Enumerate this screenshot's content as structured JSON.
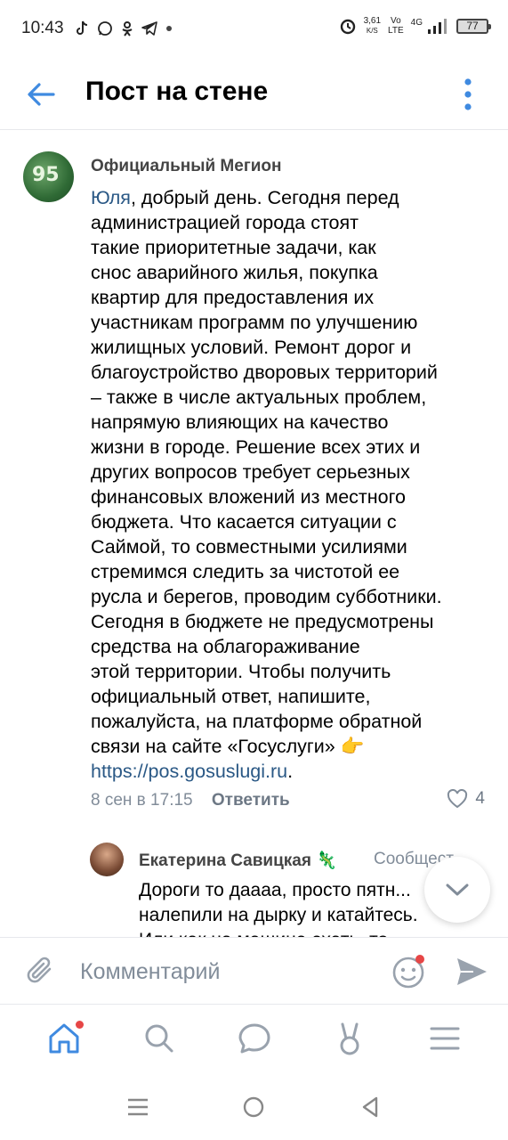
{
  "status_bar": {
    "time": "10:43",
    "net_speed": "3,61",
    "net_unit": "K/S",
    "volte_top": "Vo",
    "volte_bottom": "LTE",
    "signal_label": "4G",
    "battery": "77"
  },
  "header": {
    "title": "Пост на стене"
  },
  "comment": {
    "author": "Официальный Мегион",
    "avatar_text": "95",
    "mention": "Юля",
    "text_lines": [
      ", добрый день. Сегодня перед",
      "администрацией города стоят",
      "такие приоритетные задачи, как",
      "снос аварийного жилья, покупка",
      "квартир для предоставления их",
      "участникам программ по улучшению",
      "жилищных условий. Ремонт дорог и",
      "благоустройство дворовых территорий",
      "– также в числе актуальных проблем,",
      "напрямую влияющих на качество",
      "жизни в городе. Решение всех этих и",
      "других вопросов требует серьезных",
      "финансовых вложений из местного",
      "бюджета. Что касается ситуации с",
      "Саймой, то совместными усилиями",
      "стремимся следить за чистотой ее",
      "русла и берегов, проводим субботники.",
      "Сегодня в бюджете не предусмотрены",
      "средства на облагораживание",
      "этой территории. Чтобы получить",
      "официальный ответ, напишите,",
      "пожалуйста, на платформе обратной",
      "связи на сайте «Госуслуги» 👉"
    ],
    "link": "https://pos.gosuslugi.ru",
    "link_suffix": ".",
    "date": "8 сен в 17:15",
    "reply_label": "Ответить",
    "likes": "4"
  },
  "reply": {
    "author": "Екатерина Савицкая 🦎",
    "tag": "Сообщест...",
    "text_lines": [
      "Дороги то даааа, просто пятн...",
      "налепили на дырку и катайтесь.",
      "Или как на машине ехать, то..."
    ]
  },
  "composer": {
    "placeholder": "Комментарий"
  },
  "colors": {
    "accent": "#2a5885",
    "icon_blue": "#3f8ae0",
    "muted": "#818c99",
    "notification": "#e64646"
  }
}
